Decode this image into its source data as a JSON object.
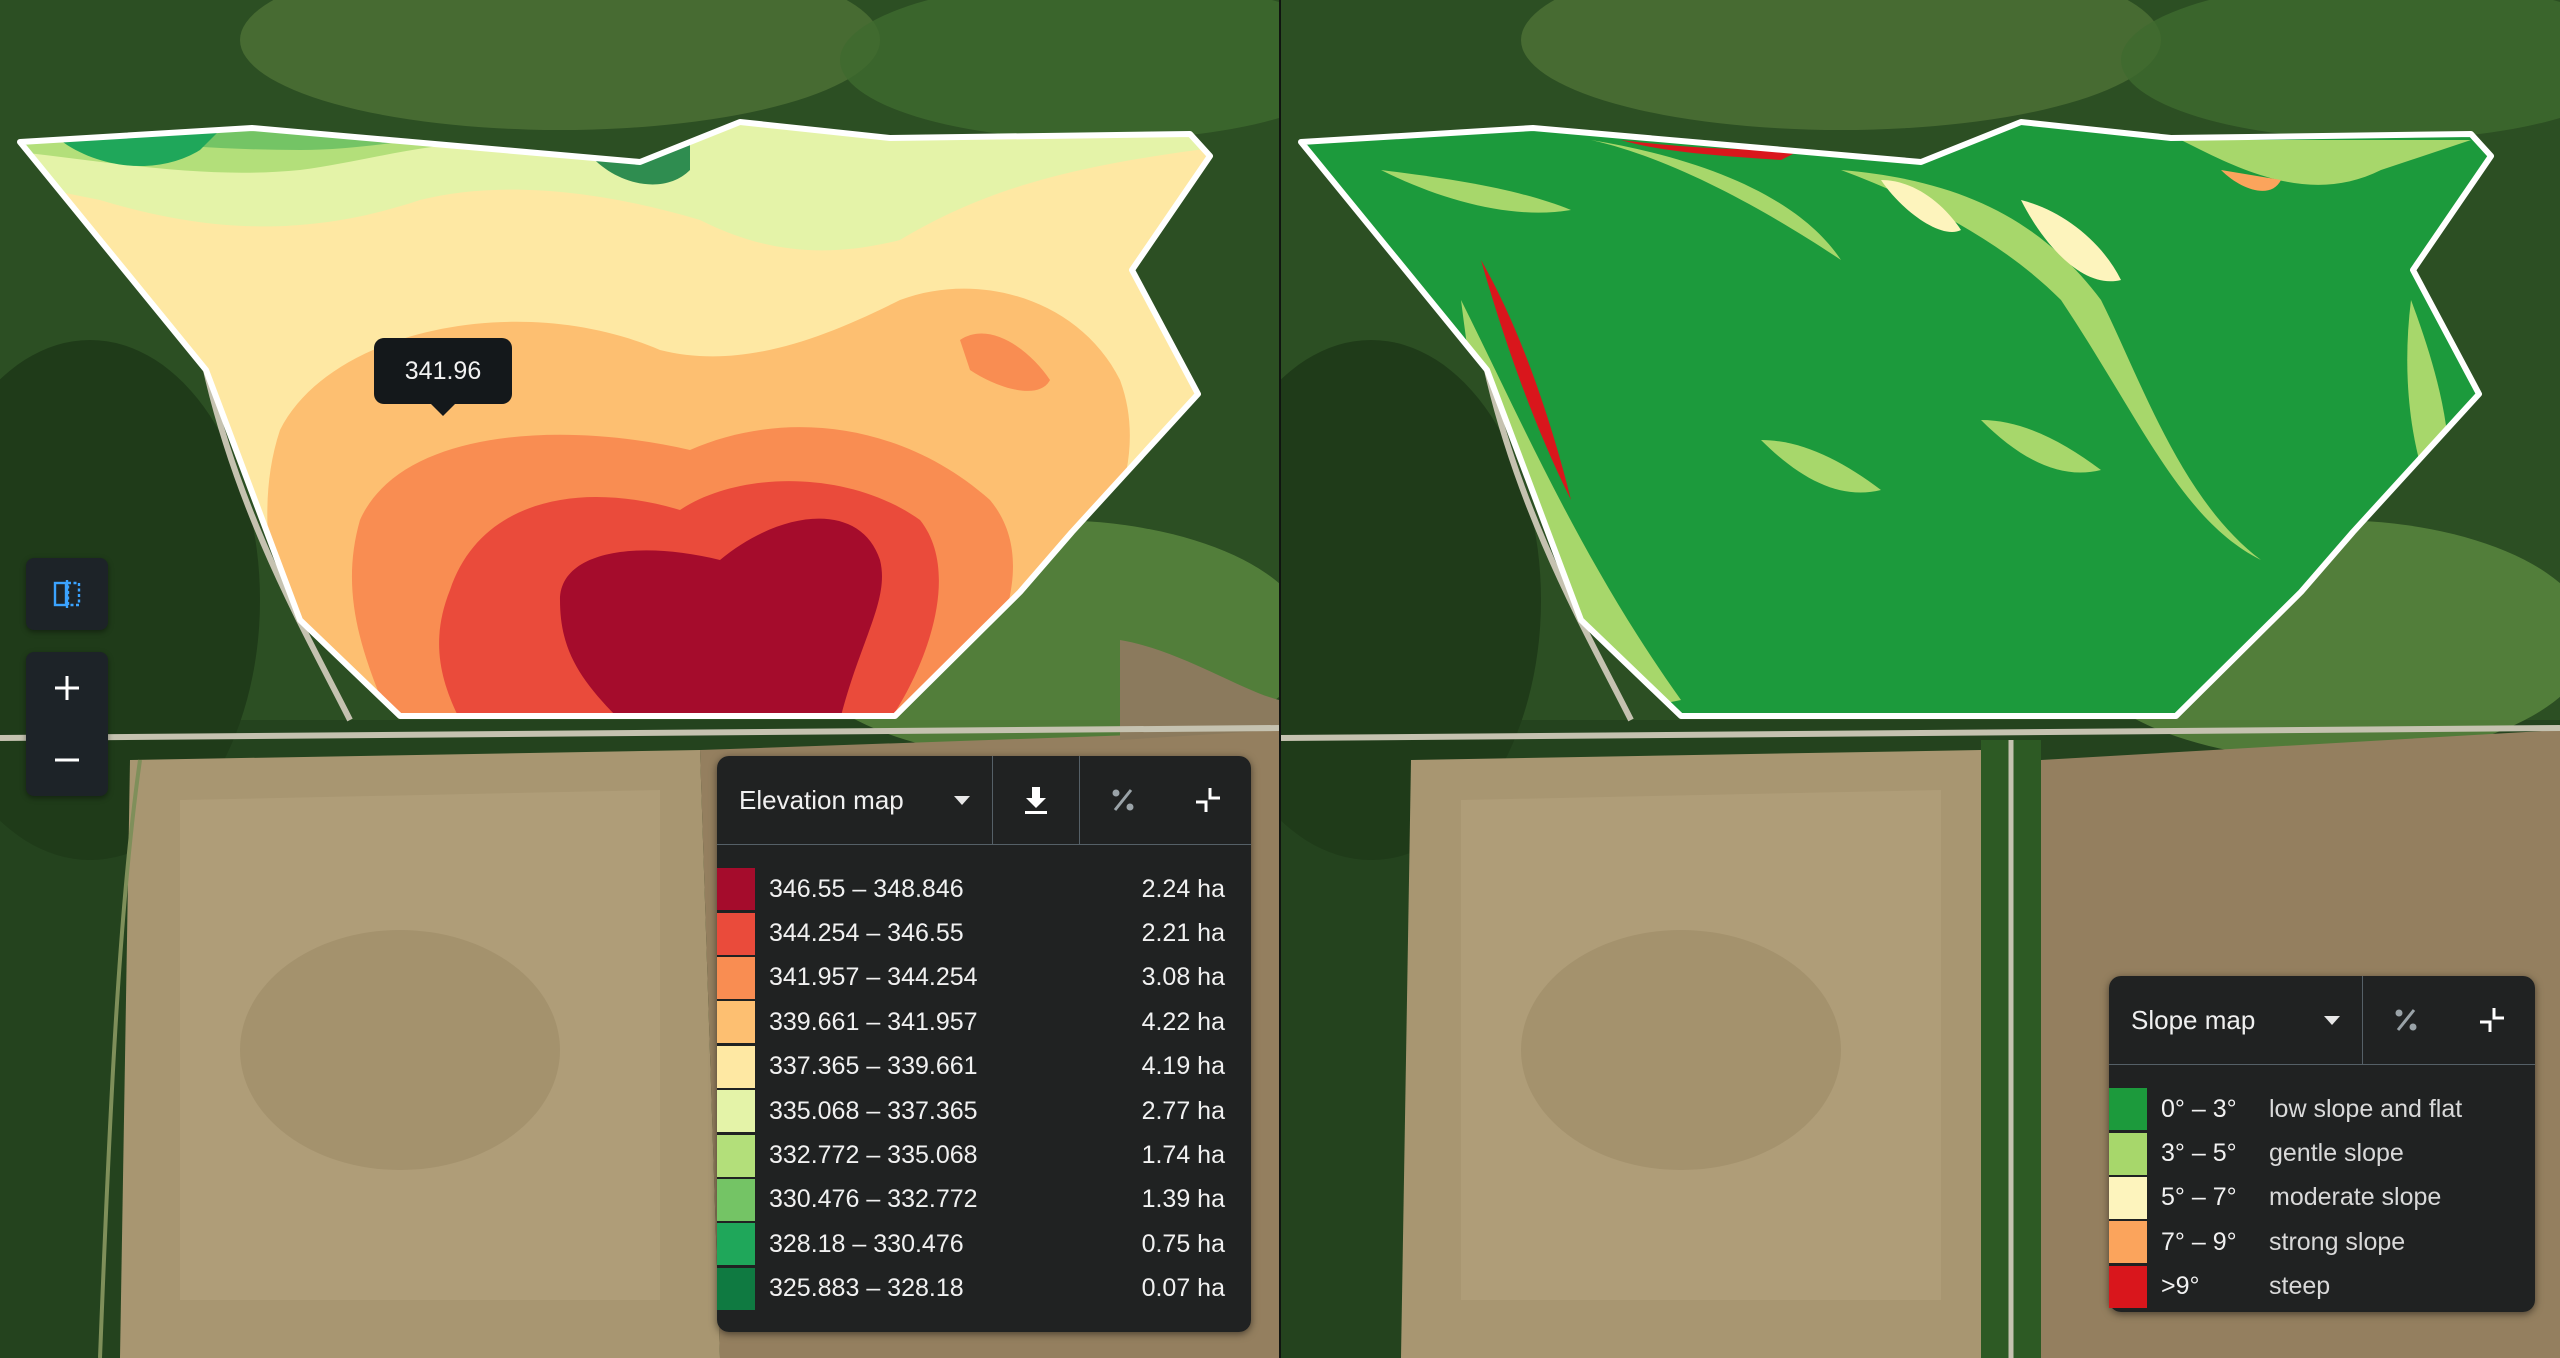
{
  "tooltip": {
    "value": "341.96"
  },
  "map_controls": [
    {
      "icon": "compare-split-icon"
    },
    {
      "icon": "zoom-in-icon"
    },
    {
      "icon": "zoom-out-icon"
    }
  ],
  "elevation_panel": {
    "title": "Elevation map",
    "tools": [
      "download-icon",
      "percent-icon",
      "collapse-icon"
    ],
    "legend": [
      {
        "range": "346.55 – 348.846",
        "area": "2.24 ha",
        "color": "#a50c2c"
      },
      {
        "range": "344.254 – 346.55",
        "area": "2.21 ha",
        "color": "#ea4b3b"
      },
      {
        "range": "341.957 – 344.254",
        "area": "3.08 ha",
        "color": "#f98d52"
      },
      {
        "range": "339.661 – 341.957",
        "area": "4.22 ha",
        "color": "#fdbf71"
      },
      {
        "range": "337.365 – 339.661",
        "area": "4.19 ha",
        "color": "#fee8a3"
      },
      {
        "range": "335.068 – 337.365",
        "area": "2.77 ha",
        "color": "#e4f3a8"
      },
      {
        "range": "332.772 – 335.068",
        "area": "1.74 ha",
        "color": "#b3df7a"
      },
      {
        "range": "330.476 – 332.772",
        "area": "1.39 ha",
        "color": "#74c465"
      },
      {
        "range": "328.18 – 330.476",
        "area": "0.75 ha",
        "color": "#1fa75a"
      },
      {
        "range": "325.883 – 328.18",
        "area": "0.07 ha",
        "color": "#0f7a41"
      }
    ]
  },
  "slope_panel": {
    "title": "Slope map",
    "tools": [
      "percent-icon",
      "collapse-icon"
    ],
    "legend": [
      {
        "range": "0° – 3°",
        "label": "low slope and flat",
        "color": "#1c9a3c"
      },
      {
        "range": "3° – 5°",
        "label": "gentle slope",
        "color": "#a7d76b"
      },
      {
        "range": "5° – 7°",
        "label": "moderate slope",
        "color": "#fdf4bd"
      },
      {
        "range": "7° – 9°",
        "label": "strong slope",
        "color": "#fba45c"
      },
      {
        "range": ">9°",
        "label": "steep",
        "color": "#d9161c"
      }
    ]
  }
}
